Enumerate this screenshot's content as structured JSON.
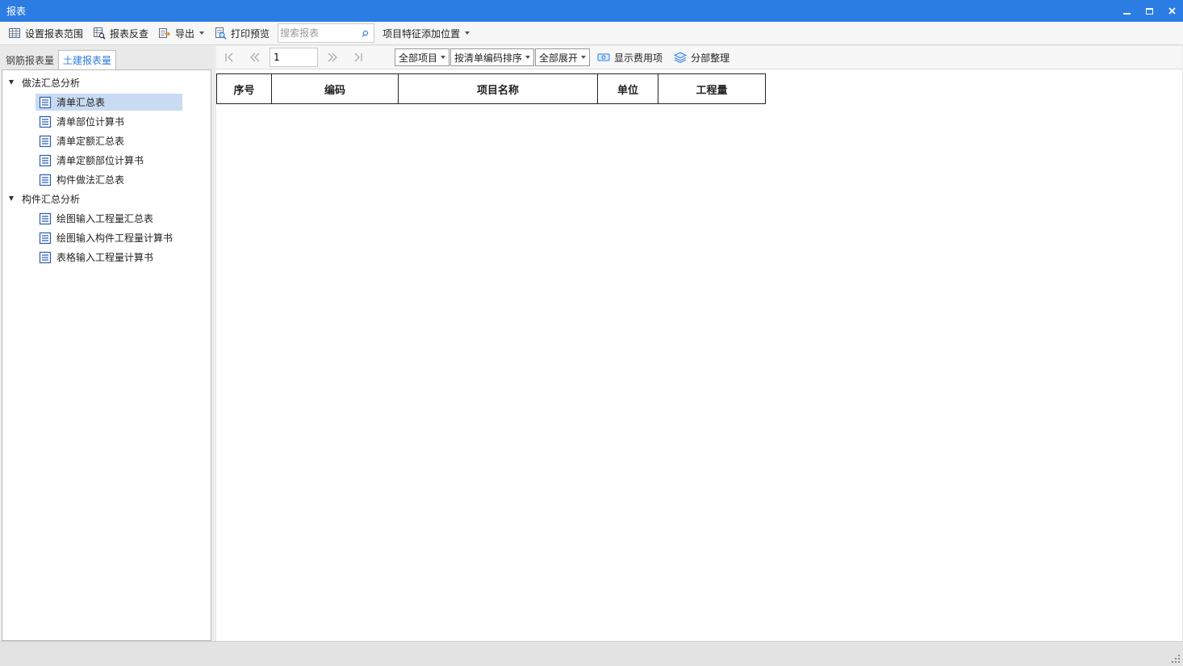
{
  "window": {
    "title": "报表"
  },
  "toolbar": {
    "set_range": "设置报表范围",
    "reverse_check": "报表反查",
    "export": "导出",
    "print_preview": "打印预览",
    "search_placeholder": "搜索报表",
    "feature_position": "项目特征添加位置"
  },
  "left_tabs": [
    {
      "label": "钢筋报表量",
      "active": false
    },
    {
      "label": "土建报表量",
      "active": true
    }
  ],
  "tree": [
    {
      "label": "做法汇总分析",
      "expanded": true,
      "items": [
        {
          "label": "清单汇总表",
          "selected": true
        },
        {
          "label": "清单部位计算书",
          "selected": false
        },
        {
          "label": "清单定额汇总表",
          "selected": false
        },
        {
          "label": "清单定额部位计算书",
          "selected": false
        },
        {
          "label": "构件做法汇总表",
          "selected": false
        }
      ]
    },
    {
      "label": "构件汇总分析",
      "expanded": true,
      "items": [
        {
          "label": "绘图输入工程量汇总表",
          "selected": false
        },
        {
          "label": "绘图输入构件工程量计算书",
          "selected": false
        },
        {
          "label": "表格输入工程量计算书",
          "selected": false
        }
      ]
    }
  ],
  "report_toolbar": {
    "page": "1",
    "scope": "全部项目",
    "sort": "按清单编码排序",
    "expand": "全部展开",
    "show_fees": "显示费用项",
    "section": "分部整理"
  },
  "table": {
    "columns": [
      "序号",
      "编码",
      "项目名称",
      "单位",
      "工程量"
    ],
    "rows": []
  },
  "colors": {
    "titlebar": "#2c7de3",
    "selection": "#c9dbf3",
    "active_tab_text": "#2c7de3"
  }
}
